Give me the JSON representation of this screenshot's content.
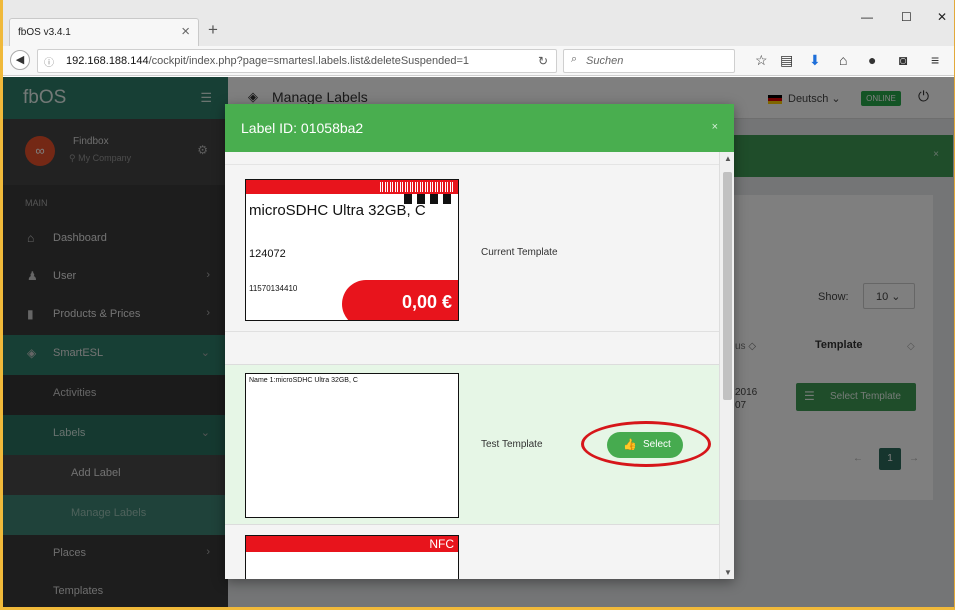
{
  "browser": {
    "tab_title": "fbOS v3.4.1",
    "url_host": "192.168.188.144",
    "url_path": "/cockpit/index.php?page=smartesl.labels.list&deleteSuspended=1",
    "search_placeholder": "Suchen"
  },
  "sidebar": {
    "logo": "fbOS",
    "profile_name": "Findbox",
    "profile_company": "My Company",
    "section": "MAIN",
    "items": {
      "dashboard": "Dashboard",
      "user": "User",
      "products": "Products & Prices",
      "smartesl": "SmartESL",
      "activities": "Activities",
      "labels": "Labels",
      "add_label": "Add Label",
      "manage_labels": "Manage Labels",
      "places": "Places",
      "templates": "Templates"
    }
  },
  "topbar": {
    "title": "Manage Labels",
    "language": "Deutsch",
    "status": "ONLINE"
  },
  "table": {
    "show_label": "Show:",
    "show_value": "10",
    "col_status_partial": "us",
    "col_template": "Template",
    "row_date_line1": "2016",
    "row_date_line2": "07",
    "select_template_btn": "Select Template",
    "page": "1"
  },
  "modal": {
    "title": "Label ID: 01058ba2",
    "current": {
      "template_name": "Current Template",
      "product_name": "microSDHC Ultra 32GB, C",
      "number": "124072",
      "ean": "11570134410",
      "price": "0,00 €"
    },
    "test": {
      "template_name": "Test Template",
      "field_text": "Name 1:microSDHC Ultra 32GB, C",
      "select_label": "Select"
    },
    "third": {
      "badge": "NFC"
    }
  },
  "colors": {
    "brand_green": "#2f7f6a",
    "modal_green": "#49ae4f",
    "label_red": "#e8141c",
    "highlight_circle": "#d6161a"
  }
}
